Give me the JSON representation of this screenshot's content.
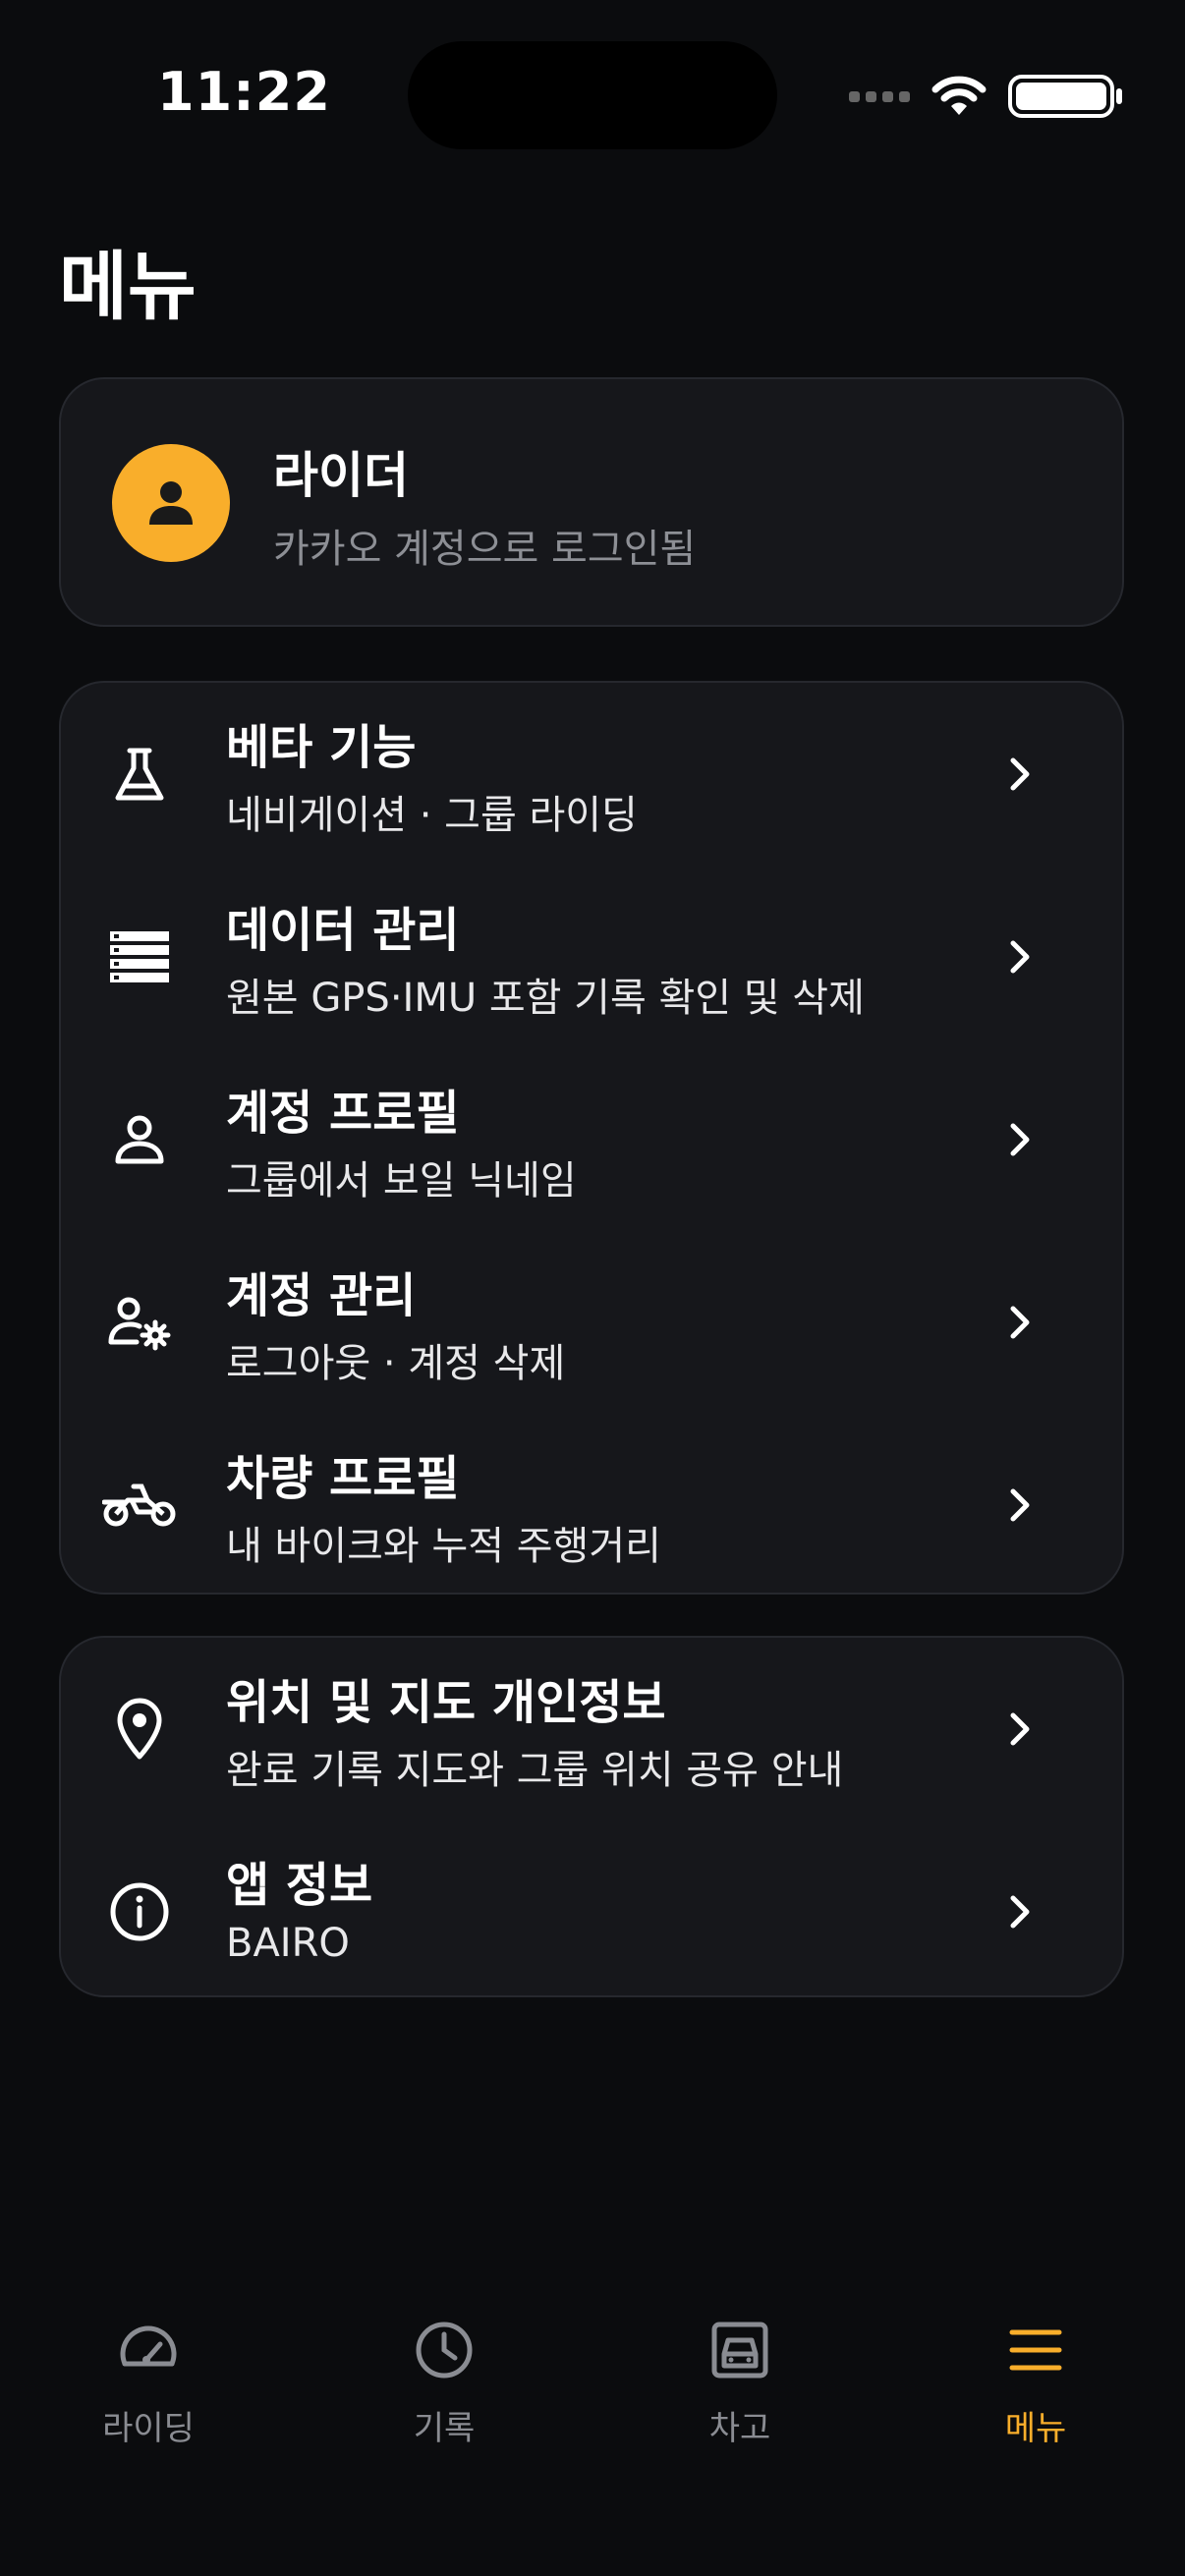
{
  "status_bar": {
    "time": "11:22"
  },
  "page": {
    "title": "메뉴"
  },
  "profile": {
    "name": "라이더",
    "subtitle": "카카오 계정으로 로그인됨"
  },
  "menu_group_1": [
    {
      "title": "베타 기능",
      "subtitle": "네비게이션 · 그룹 라이딩",
      "icon": "flask-icon"
    },
    {
      "title": "데이터 관리",
      "subtitle": "원본 GPS·IMU 포함 기록 확인 및 삭제",
      "icon": "database-icon"
    },
    {
      "title": "계정 프로필",
      "subtitle": "그룹에서 보일 닉네임",
      "icon": "person-icon"
    },
    {
      "title": "계정 관리",
      "subtitle": "로그아웃 · 계정 삭제",
      "icon": "person-gear-icon"
    },
    {
      "title": "차량 프로필",
      "subtitle": "내 바이크와 누적 주행거리",
      "icon": "motorcycle-icon"
    }
  ],
  "menu_group_2": [
    {
      "title": "위치 및 지도 개인정보",
      "subtitle": "완료 기록 지도와 그룹 위치 공유 안내",
      "icon": "location-pin-icon"
    },
    {
      "title": "앱 정보",
      "subtitle": "BAIRO",
      "icon": "info-icon"
    }
  ],
  "tabs": [
    {
      "label": "라이딩",
      "icon": "speedometer-icon",
      "active": false
    },
    {
      "label": "기록",
      "icon": "clock-icon",
      "active": false
    },
    {
      "label": "차고",
      "icon": "garage-icon",
      "active": false
    },
    {
      "label": "메뉴",
      "icon": "menu-icon",
      "active": true
    }
  ],
  "colors": {
    "accent": "#f9ae2b",
    "background": "#0b0c0e",
    "card": "#16171b",
    "muted": "#8a8c92"
  }
}
